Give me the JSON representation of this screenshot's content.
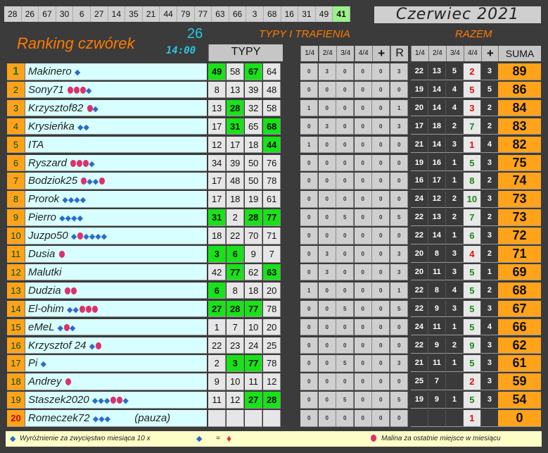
{
  "top_numbers": [
    "28",
    "26",
    "67",
    "30",
    "6",
    "27",
    "14",
    "35",
    "21",
    "44",
    "79",
    "77",
    "63",
    "66",
    "3",
    "68",
    "16",
    "31",
    "49",
    "41"
  ],
  "month_label": "Czerwiec 2021",
  "title": "Ranking czwórek",
  "round_number": "26",
  "round_time": "14:00",
  "section_typy": "TYPY I TRAFIENIA",
  "section_razem": "RAZEM",
  "col_typy": "TYPY",
  "stat_cols": [
    "1/4",
    "2/4",
    "3/4",
    "4/4",
    "+",
    "R"
  ],
  "razem_cols": [
    "1/4",
    "2/4",
    "3/4",
    "4/4",
    "+"
  ],
  "col_suma": "SUMA",
  "rows": [
    {
      "rank": "1",
      "name": "Makinero",
      "dia": 1,
      "ras": 0,
      "extra": "",
      "typy": [
        "49",
        "58",
        "67",
        "64"
      ],
      "hits": [
        1,
        0,
        1,
        0
      ],
      "stats": [
        "0",
        "3",
        "0",
        "0",
        "0",
        "3"
      ],
      "razem": [
        "22",
        "13",
        "5",
        "2",
        "3"
      ],
      "q4red": true,
      "suma": "89"
    },
    {
      "rank": "2",
      "name": "Sony71",
      "dia": 0,
      "ras": 3,
      "dia_after": 1,
      "extra": "",
      "typy": [
        "8",
        "13",
        "39",
        "48"
      ],
      "hits": [
        0,
        0,
        0,
        0
      ],
      "stats": [
        "0",
        "0",
        "0",
        "0",
        "0",
        "0"
      ],
      "razem": [
        "19",
        "14",
        "4",
        "5",
        "5"
      ],
      "q4red": true,
      "suma": "86"
    },
    {
      "rank": "3",
      "name": "Krzysztof82",
      "dia": 0,
      "ras": 1,
      "dia_after": 1,
      "extra": "",
      "typy": [
        "13",
        "28",
        "32",
        "58"
      ],
      "hits": [
        0,
        1,
        0,
        0
      ],
      "stats": [
        "1",
        "0",
        "0",
        "0",
        "0",
        "1"
      ],
      "razem": [
        "20",
        "14",
        "4",
        "3",
        "2"
      ],
      "q4red": true,
      "suma": "84"
    },
    {
      "rank": "4",
      "name": "Krysieńka",
      "dia": 2,
      "ras": 0,
      "extra": "",
      "typy": [
        "17",
        "31",
        "65",
        "68"
      ],
      "hits": [
        0,
        1,
        0,
        1
      ],
      "stats": [
        "0",
        "3",
        "0",
        "0",
        "0",
        "3"
      ],
      "razem": [
        "17",
        "18",
        "2",
        "7",
        "2"
      ],
      "q4red": false,
      "suma": "83"
    },
    {
      "rank": "5",
      "name": "ITA",
      "dia": 0,
      "ras": 0,
      "extra": "",
      "typy": [
        "12",
        "17",
        "18",
        "44"
      ],
      "hits": [
        0,
        0,
        0,
        1
      ],
      "stats": [
        "1",
        "0",
        "0",
        "0",
        "0",
        "0"
      ],
      "razem": [
        "21",
        "14",
        "3",
        "1",
        "4"
      ],
      "q4red": true,
      "suma": "82"
    },
    {
      "rank": "6",
      "name": "Ryszard",
      "dia": 0,
      "ras": 3,
      "dia_after": 1,
      "extra": "",
      "typy": [
        "34",
        "39",
        "50",
        "76"
      ],
      "hits": [
        0,
        0,
        0,
        0
      ],
      "stats": [
        "0",
        "0",
        "0",
        "0",
        "0",
        "0"
      ],
      "razem": [
        "19",
        "16",
        "1",
        "5",
        "3"
      ],
      "q4red": false,
      "suma": "75"
    },
    {
      "rank": "7",
      "name": "Bodziok25",
      "dia": 0,
      "ras": 1,
      "dia_after": 2,
      "ras_after": 1,
      "extra": "",
      "typy": [
        "17",
        "48",
        "50",
        "78"
      ],
      "hits": [
        0,
        0,
        0,
        0
      ],
      "stats": [
        "0",
        "0",
        "0",
        "0",
        "0",
        "0"
      ],
      "razem": [
        "16",
        "17",
        "1",
        "8",
        "2"
      ],
      "q4red": false,
      "suma": "74"
    },
    {
      "rank": "8",
      "name": "Prorok",
      "dia": 4,
      "ras": 0,
      "extra": "",
      "typy": [
        "17",
        "18",
        "19",
        "61"
      ],
      "hits": [
        0,
        0,
        0,
        0
      ],
      "stats": [
        "0",
        "0",
        "0",
        "0",
        "0",
        "0"
      ],
      "razem": [
        "24",
        "12",
        "2",
        "10",
        "3"
      ],
      "q4red": false,
      "suma": "73"
    },
    {
      "rank": "9",
      "name": "Pierro",
      "dia": 4,
      "ras": 0,
      "extra": "",
      "typy": [
        "31",
        "2",
        "28",
        "77"
      ],
      "hits": [
        1,
        0,
        1,
        1
      ],
      "stats": [
        "0",
        "0",
        "5",
        "0",
        "0",
        "5"
      ],
      "razem": [
        "22",
        "13",
        "2",
        "7",
        "2"
      ],
      "q4red": false,
      "suma": "73"
    },
    {
      "rank": "10",
      "name": "Juzpo50",
      "dia": 1,
      "ras": 1,
      "dia_after": 4,
      "extra": "",
      "typy": [
        "18",
        "22",
        "70",
        "71"
      ],
      "hits": [
        0,
        0,
        0,
        0
      ],
      "stats": [
        "0",
        "0",
        "0",
        "0",
        "0",
        "0"
      ],
      "razem": [
        "22",
        "14",
        "1",
        "6",
        "3"
      ],
      "q4red": false,
      "suma": "72"
    },
    {
      "rank": "11",
      "name": "Dusia",
      "dia": 0,
      "ras": 1,
      "extra": "",
      "typy": [
        "3",
        "6",
        "9",
        "7"
      ],
      "hits": [
        1,
        1,
        0,
        0
      ],
      "stats": [
        "0",
        "3",
        "0",
        "0",
        "0",
        "3"
      ],
      "razem": [
        "20",
        "8",
        "3",
        "4",
        "2"
      ],
      "q4red": true,
      "suma": "71"
    },
    {
      "rank": "12",
      "name": "Malutki",
      "dia": 0,
      "ras": 0,
      "extra": "",
      "typy": [
        "42",
        "77",
        "62",
        "63"
      ],
      "hits": [
        0,
        1,
        0,
        1
      ],
      "stats": [
        "0",
        "3",
        "0",
        "0",
        "0",
        "3"
      ],
      "razem": [
        "20",
        "11",
        "3",
        "5",
        "1"
      ],
      "q4red": false,
      "suma": "69"
    },
    {
      "rank": "13",
      "name": "Dudzia",
      "dia": 0,
      "ras": 2,
      "extra": "",
      "typy": [
        "6",
        "8",
        "18",
        "20"
      ],
      "hits": [
        1,
        0,
        0,
        0
      ],
      "stats": [
        "1",
        "0",
        "0",
        "0",
        "0",
        "1"
      ],
      "razem": [
        "22",
        "8",
        "4",
        "5",
        "2"
      ],
      "q4red": false,
      "suma": "68"
    },
    {
      "rank": "14",
      "name": "El-ohim",
      "dia": 2,
      "ras": 3,
      "extra": "",
      "typy": [
        "27",
        "28",
        "77",
        "78"
      ],
      "hits": [
        1,
        1,
        1,
        0
      ],
      "stats": [
        "0",
        "0",
        "5",
        "0",
        "0",
        "5"
      ],
      "razem": [
        "22",
        "9",
        "3",
        "5",
        "3"
      ],
      "q4red": false,
      "suma": "67"
    },
    {
      "rank": "15",
      "name": "eMeL",
      "dia": 1,
      "ras": 1,
      "dia_after": 1,
      "extra": "",
      "typy": [
        "1",
        "7",
        "10",
        "20"
      ],
      "hits": [
        0,
        0,
        0,
        0
      ],
      "stats": [
        "0",
        "0",
        "0",
        "0",
        "0",
        "0"
      ],
      "razem": [
        "24",
        "11",
        "1",
        "5",
        "4"
      ],
      "q4red": false,
      "suma": "66"
    },
    {
      "rank": "16",
      "name": "Krzysztof 24",
      "dia": 1,
      "ras": 1,
      "extra": "",
      "typy": [
        "22",
        "23",
        "24",
        "25"
      ],
      "hits": [
        0,
        0,
        0,
        0
      ],
      "stats": [
        "0",
        "0",
        "0",
        "0",
        "0",
        "0"
      ],
      "razem": [
        "22",
        "9",
        "2",
        "9",
        "3"
      ],
      "q4red": false,
      "suma": "62"
    },
    {
      "rank": "17",
      "name": "Pi",
      "dia": 1,
      "ras": 0,
      "extra": "",
      "typy": [
        "2",
        "3",
        "77",
        "78"
      ],
      "hits": [
        0,
        1,
        1,
        0
      ],
      "stats": [
        "0",
        "0",
        "5",
        "0",
        "0",
        "3"
      ],
      "razem": [
        "21",
        "11",
        "1",
        "5",
        "3"
      ],
      "q4red": false,
      "suma": "61"
    },
    {
      "rank": "18",
      "name": "Andrey",
      "dia": 0,
      "ras": 1,
      "extra": "",
      "typy": [
        "9",
        "10",
        "11",
        "12"
      ],
      "hits": [
        0,
        0,
        0,
        0
      ],
      "stats": [
        "0",
        "0",
        "0",
        "0",
        "0",
        "0"
      ],
      "razem": [
        "25",
        "7",
        "",
        "2",
        "3"
      ],
      "q4red": true,
      "suma": "59"
    },
    {
      "rank": "19",
      "name": "Staszek2020",
      "dia": 3,
      "ras": 2,
      "dia_after": 1,
      "extra": "",
      "typy": [
        "11",
        "12",
        "27",
        "28"
      ],
      "hits": [
        0,
        0,
        1,
        1
      ],
      "stats": [
        "0",
        "0",
        "5",
        "0",
        "0",
        "5"
      ],
      "razem": [
        "19",
        "9",
        "1",
        "5",
        "3"
      ],
      "q4red": false,
      "suma": "54"
    },
    {
      "rank": "20",
      "name": "Romeczek72",
      "dia": 3,
      "ras": 0,
      "extra": "(pauza)",
      "typy": [
        "",
        "",
        "",
        ""
      ],
      "hits": [
        0,
        0,
        0,
        0
      ],
      "stats": [
        "0",
        "0",
        "0",
        "0",
        "0",
        "0"
      ],
      "razem": [
        "",
        "",
        "",
        "1",
        ""
      ],
      "q4red": true,
      "suma": "0"
    }
  ],
  "footer_left": "Wyróżnienie za zwycięstwo miesiąca  10 x",
  "footer_eq": "=",
  "footer_right": "Malina za ostatnie miejsce w miesiącu",
  "colors": {
    "accent": "#ff7a00",
    "hit": "#19e219",
    "cyan": "#29c6e0",
    "rank_bg": "#ffa31a",
    "name_bg": "#d8ffff"
  }
}
